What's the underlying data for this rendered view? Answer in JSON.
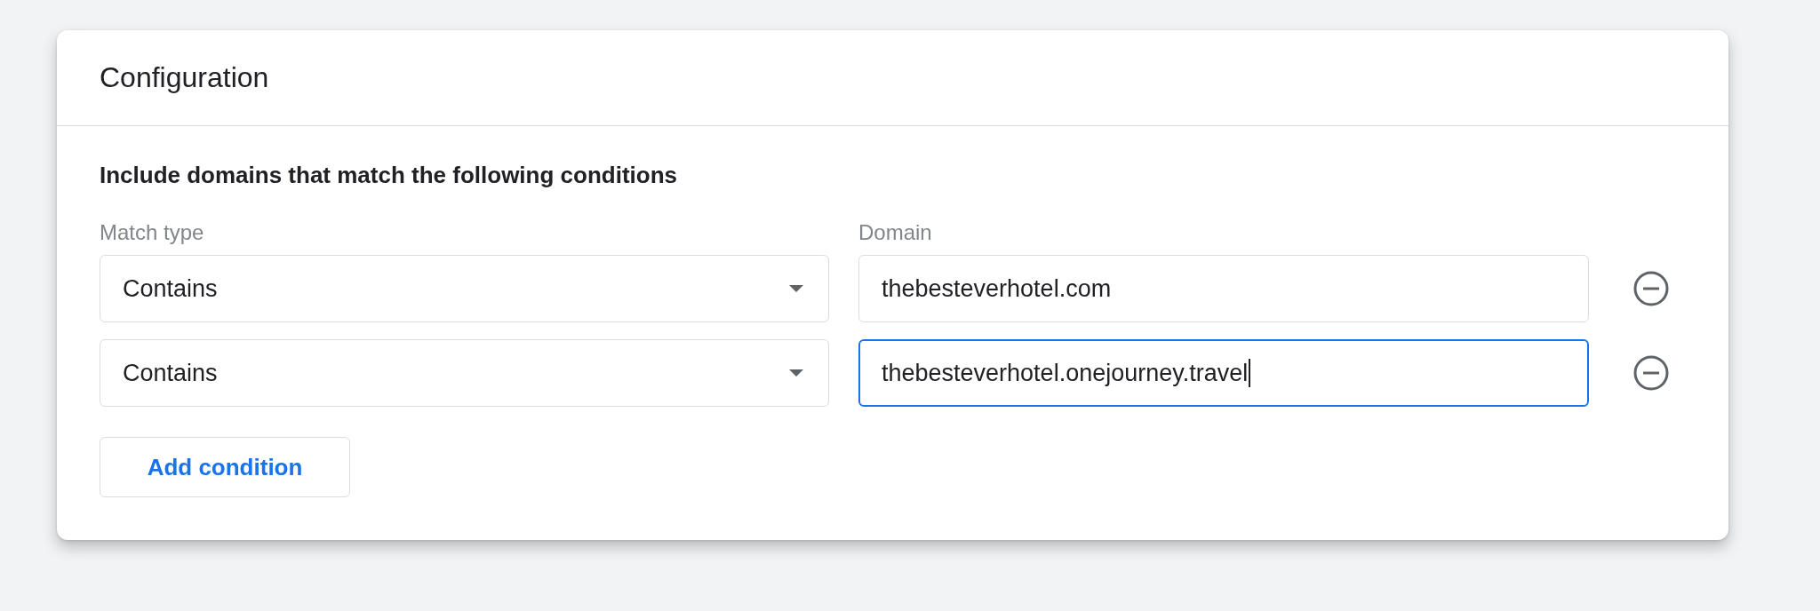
{
  "header": {
    "title": "Configuration"
  },
  "section": {
    "title": "Include domains that match the following conditions"
  },
  "columns": {
    "match_type_label": "Match type",
    "domain_label": "Domain"
  },
  "conditions": [
    {
      "match_type": "Contains",
      "domain": "thebesteverhotel.com",
      "focused": false
    },
    {
      "match_type": "Contains",
      "domain": "thebesteverhotel.onejourney.travel",
      "focused": true
    }
  ],
  "add_button": {
    "label": "Add condition"
  }
}
